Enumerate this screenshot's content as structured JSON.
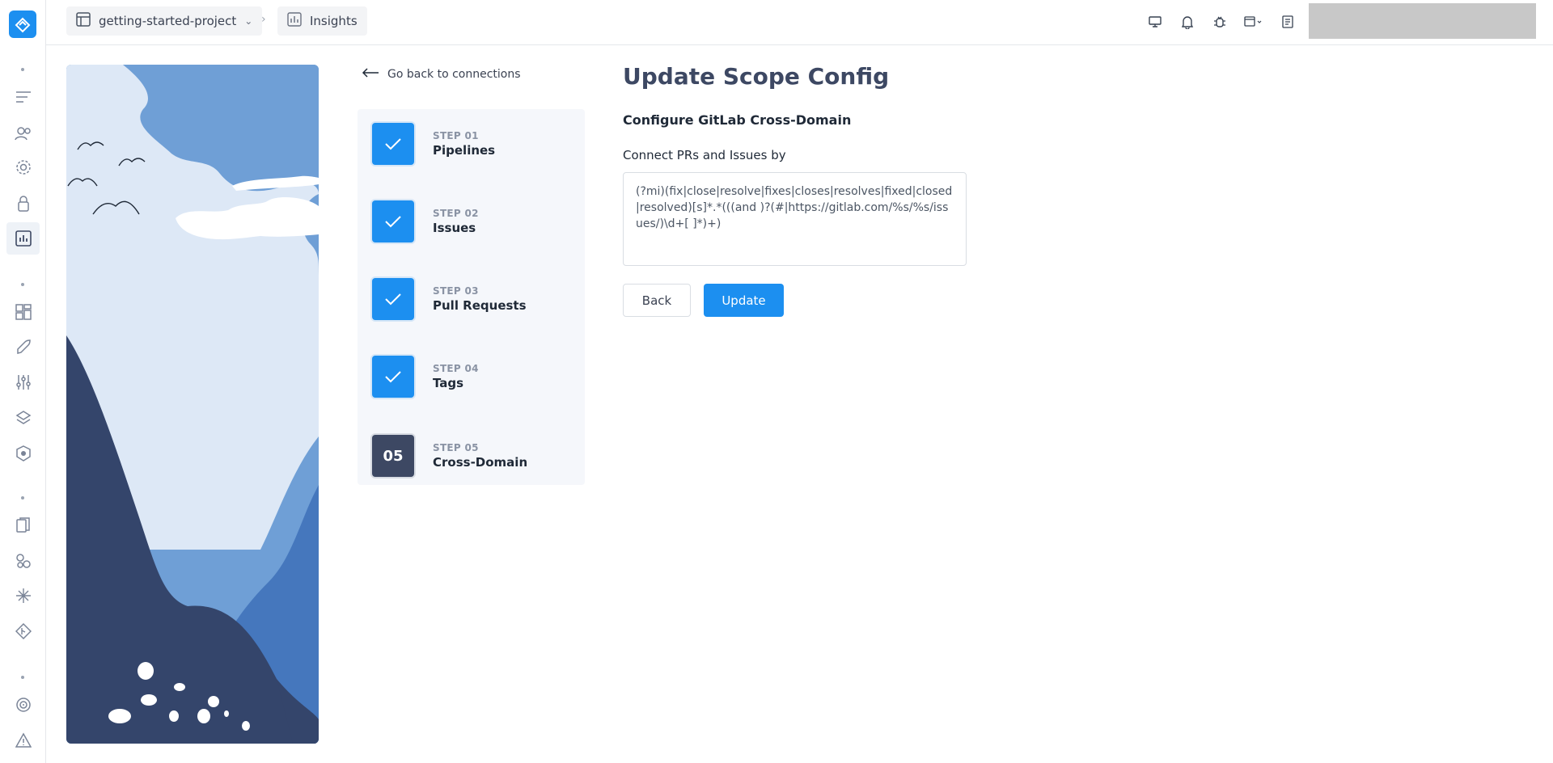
{
  "topbar": {
    "project": "getting-started-project",
    "section": "Insights"
  },
  "nav": {
    "back_label": "Go back to connections"
  },
  "steps": [
    {
      "number": "STEP 01",
      "name": "Pipelines",
      "state": "done"
    },
    {
      "number": "STEP 02",
      "name": "Issues",
      "state": "done"
    },
    {
      "number": "STEP 03",
      "name": "Pull Requests",
      "state": "done"
    },
    {
      "number": "STEP 04",
      "name": "Tags",
      "state": "done"
    },
    {
      "number": "STEP 05",
      "name": "Cross-Domain",
      "state": "current",
      "badge": "05"
    }
  ],
  "form": {
    "title": "Update Scope Config",
    "subtitle": "Configure GitLab Cross-Domain",
    "field_label": "Connect PRs and Issues by",
    "field_value": "(?mi)(fix|close|resolve|fixes|closes|resolves|fixed|closed|resolved)[s]*.*(((and )?(#|https://gitlab.com/%s/%s/issues/)\\d+[ ]*)+)",
    "back_button": "Back",
    "update_button": "Update"
  },
  "colors": {
    "accent": "#1c8ff0",
    "title": "#3d4863",
    "current_step": "#3d4863"
  }
}
